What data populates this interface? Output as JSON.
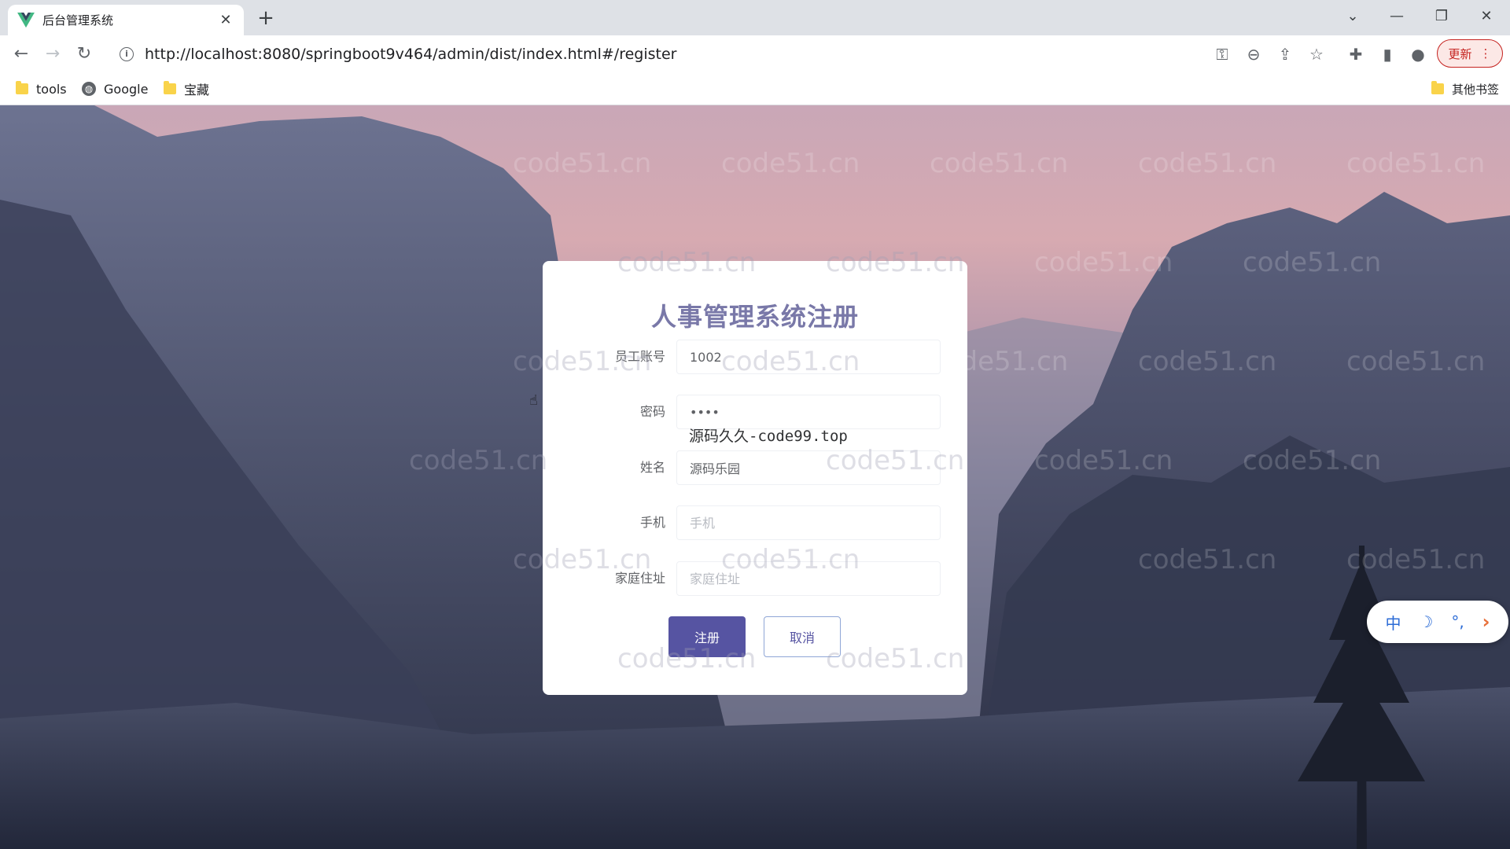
{
  "browser": {
    "tab_title": "后台管理系统",
    "tab_close": "✕",
    "new_tab": "+",
    "url": "http://localhost:8080/springboot9v464/admin/dist/index.html#/register",
    "update_label": "更新",
    "window_controls": [
      "⌄",
      "—",
      "❐",
      "✕"
    ],
    "toolbar_icons": [
      "key-icon",
      "zoom-out-icon",
      "share-icon",
      "star-icon",
      "extensions-icon",
      "sidepanel-icon",
      "profile-icon"
    ]
  },
  "bookmarks": {
    "items": [
      {
        "label": "tools",
        "icon": "folder-icon"
      },
      {
        "label": "Google",
        "icon": "globe-icon"
      },
      {
        "label": "宝藏",
        "icon": "folder-icon"
      }
    ],
    "other": "其他书签"
  },
  "watermark_text": "code51.cn",
  "form": {
    "title": "人事管理系统注册",
    "fields": [
      {
        "label": "员工账号",
        "value": "1002",
        "placeholder": "员工账号",
        "type": "text"
      },
      {
        "label": "密码",
        "value": "1234",
        "placeholder": "密码",
        "type": "password"
      },
      {
        "label": "姓名",
        "value": "源码乐园",
        "placeholder": "姓名",
        "type": "text"
      },
      {
        "label": "手机",
        "value": "",
        "placeholder": "手机",
        "type": "text"
      },
      {
        "label": "家庭住址",
        "value": "",
        "placeholder": "家庭住址",
        "type": "text"
      }
    ],
    "overlay_note": "源码久久-code99.top",
    "register_button": "注册",
    "cancel_button": "取消"
  },
  "ime": {
    "mode": "中",
    "moon": "☽",
    "punct": "°,",
    "arrow": "›"
  },
  "colors": {
    "accent": "#5654a2",
    "title": "#7978a8",
    "update": "#c5221f"
  }
}
